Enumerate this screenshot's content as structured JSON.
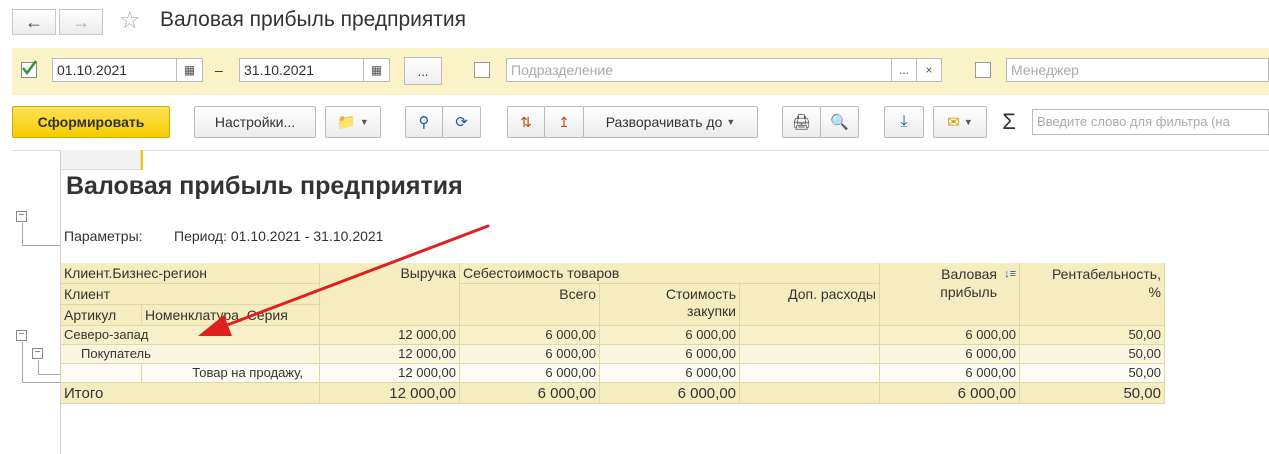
{
  "window": {
    "title": "Валовая прибыль предприятия",
    "back_icon": "arrow-left-icon",
    "forward_icon": "arrow-right-icon",
    "favorite_icon": "star-icon"
  },
  "filters": {
    "period_enabled": true,
    "date_from": "01.10.2021",
    "date_sep": "–",
    "date_to": "31.10.2021",
    "period_picker_label": "...",
    "division_placeholder": "Подразделение",
    "division_select_label": "...",
    "division_clear_label": "×",
    "manager_placeholder": "Менеджер"
  },
  "toolbar": {
    "generate_label": "Сформировать",
    "settings_label": "Настройки...",
    "expand_to_label": "Разворачивать до",
    "search_placeholder": "Введите слово для фильтра (на",
    "sum_label": "Σ"
  },
  "report": {
    "title": "Валовая прибыль предприятия",
    "params_label": "Параметры:",
    "params_value": "Период: 01.10.2021 - 31.10.2021",
    "headers": {
      "client_region": "Клиент.Бизнес-регион",
      "client": "Клиент",
      "article": "Артикул",
      "nomenclature": "Номенклатура, Серия",
      "revenue": "Выручка",
      "cost_goods": "Себестоимость товаров",
      "cost_total": "Всего",
      "cost_purchase_1": "Стоимость",
      "cost_purchase_2": "закупки",
      "extra_costs": "Доп. расходы",
      "gross_profit_1": "Валовая",
      "gross_profit_2": "прибыль",
      "profitability_1": "Рентабельность,",
      "profitability_2": "%"
    },
    "rows": [
      {
        "label": "Северо-запад",
        "revenue": "12 000,00",
        "cost_total": "6 000,00",
        "cost_purchase": "6 000,00",
        "extra": "",
        "profit": "6 000,00",
        "profitability": "50,00"
      },
      {
        "label": "Покупатель",
        "revenue": "12 000,00",
        "cost_total": "6 000,00",
        "cost_purchase": "6 000,00",
        "extra": "",
        "profit": "6 000,00",
        "profitability": "50,00"
      },
      {
        "label": "Товар на продажу,",
        "revenue": "12 000,00",
        "cost_total": "6 000,00",
        "cost_purchase": "6 000,00",
        "extra": "",
        "profit": "6 000,00",
        "profitability": "50,00"
      }
    ],
    "total": {
      "label": "Итого",
      "revenue": "12 000,00",
      "cost_total": "6 000,00",
      "cost_purchase": "6 000,00",
      "extra": "",
      "profit": "6 000,00",
      "profitability": "50,00"
    }
  },
  "colors": {
    "accent_yellow": "#f5cc00",
    "filter_strip": "#fbf3c8",
    "header_fill": "#f5ecbf",
    "annotation_arrow": "#e02020"
  }
}
